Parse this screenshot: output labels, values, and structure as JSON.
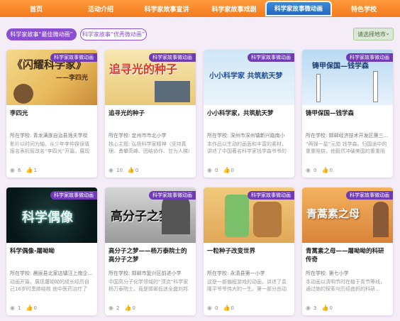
{
  "nav": {
    "items": [
      "首页",
      "活动介绍",
      "科学家故事宣讲",
      "科学家故事戏剧",
      "科学家故事微动画",
      "特色学校"
    ],
    "active_index": 4
  },
  "filters": {
    "active": "科学家故事“最佳微动画”",
    "inactive": "科学家故事“优秀微动画”",
    "region": "请选择地市"
  },
  "card_tag": "科学家故事微动画",
  "cards": [
    {
      "title": "李四光",
      "school": "所在学校: 青龙满族自治县逸夫学校",
      "desc": "影片以时间为轴，从少年李仲揆误填报名表机智改名“李四光”开篇，展现其求学时期书中求知的求知愿望，青年时期...",
      "views": "6",
      "likes": "1",
      "thumb_text": "闪耀科学家 —— 李四光"
    },
    {
      "title": "追寻光的种子",
      "school": "所在学校: 定州市市北小学",
      "desc": "核心主题: 弘扬科学家精神（坚持真理、勇攀高峰、团结协作、甘为人梯）创意说明: 用“光、种子、蒲公英”贯穿...",
      "views": "10",
      "likes": "0",
      "thumb_text": "追寻光的种子"
    },
    {
      "title": "小小科学家，共筑航天梦",
      "school": "所在学校: 深州市深州镇新兴路南小",
      "desc": "本作品以生动的画面和丰富的素材，讲述了中国著名科学家钱学森爷爷的传奇人生。从他在美国求学时的刻苦努力...",
      "views": "0",
      "likes": "0",
      "thumb_text": "小小科学家 共筑航天梦"
    },
    {
      "title": "铸甲保国—钱学森",
      "school": "所在学校: 邯郸经济技术开发区第三...",
      "desc": "“两弹一星”元勋 钱学森。归国途中的重重阻挠，他毅然冲破美国的重重阻挠回到祖国...",
      "views": "0",
      "likes": "0",
      "thumb_text": "铸甲保国—钱学森"
    },
    {
      "title": "科学偶像-屠呦呦",
      "school": "所在学校: 晨辰县北家店镇汪上南企...",
      "desc": "动画开篇，展现屠呦呦的成长经历自己16岁时患肺结核 他中医药治疗了他，让她有了学医的种子并投身医药事业...",
      "views": "1",
      "likes": "0",
      "thumb_text": "科学偶像"
    },
    {
      "title": "高分子之梦——杨万泰院士的高分子之梦",
      "school": "所在学校: 邯郸市复兴区前进小学",
      "desc": "中国高分子化学领域的“顶流”科学家杨万泰院士。竟是邯郸低迷全盛刘邦特立出出的农家子弟！1977年恢复高考，这...",
      "views": "2",
      "likes": "0",
      "thumb_text": "高分子之梦"
    },
    {
      "title": "一粒种子改变世界",
      "school": "所在学校: 永清县第一小学",
      "desc": "这是一部偏程游戏的动画，讲述了袁隆平爷爷伟大的一生。第一部分由动画讲述了袁爷爷童到人民培现的理想，噩噩...",
      "views": "0",
      "likes": "0",
      "thumb_text": ""
    },
    {
      "title": "青蒿素之母——屠呦呦的科研传奇",
      "school": "所在学校: 第七小学",
      "desc": "本动画以清明节时在植于青节等线，通过她的探索与历经曲折的科研...",
      "views": "3",
      "likes": "0",
      "thumb_text": "青蒿素之母"
    }
  ]
}
